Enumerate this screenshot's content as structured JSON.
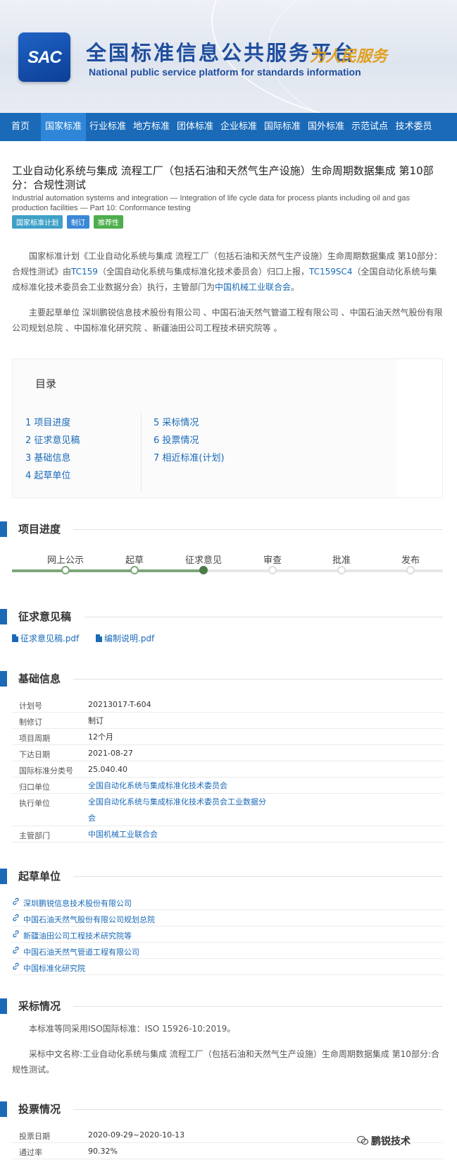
{
  "banner": {
    "logo_text": "SAC",
    "title_cn": "全国标准信息公共服务平台",
    "title_en": "National public service platform  for standards information",
    "slogan": "为人民服务"
  },
  "nav": {
    "items": [
      "首页",
      "国家标准",
      "行业标准",
      "地方标准",
      "团体标准",
      "企业标准",
      "国际标准",
      "国外标准",
      "示范试点",
      "技术委员"
    ],
    "active_index": 1
  },
  "standard": {
    "title_cn": "工业自动化系统与集成 流程工厂（包括石油和天然气生产设施）生命周期数据集成 第10部分：合规性测试",
    "title_en": "Industrial automation systems and integration — Integration of life cycle data for process plants including oil and gas production facilities — Part 10: Conformance testing",
    "tags": [
      {
        "label": "国家标准计划",
        "color": "#3fa0c8"
      },
      {
        "label": "制订",
        "color": "#3a88d8"
      },
      {
        "label": "推荐性",
        "color": "#4cae4c"
      }
    ]
  },
  "intro": {
    "p1_a": "国家标准计划《工业自动化系统与集成 流程工厂（包括石油和天然气生产设施）生命周期数据集成 第10部分：合规性测试》由",
    "p1_link1": "TC159",
    "p1_b": "（全国自动化系统与集成标准化技术委员会）归口上报，",
    "p1_link2": "TC159SC4",
    "p1_c": "（全国自动化系统与集成标准化技术委员会工业数据分会）执行，主管部门为",
    "p1_link3": "中国机械工业联合会",
    "p1_d": "。",
    "p2": "主要起草单位 深圳鹏锐信息技术股份有限公司 、中国石油天然气管道工程有限公司 、中国石油天然气股份有限公司规划总院 、中国标准化研究院 、新疆油田公司工程技术研究院等 。"
  },
  "toc": {
    "title": "目录",
    "left": [
      "1  项目进度",
      "2  征求意见稿",
      "3  基础信息",
      "4  起草单位"
    ],
    "right": [
      "5  采标情况",
      "6  投票情况",
      "7  相近标准(计划)"
    ]
  },
  "sections": {
    "progress": "项目进度",
    "drafts": "征求意见稿",
    "basic": "基础信息",
    "drafters": "起草单位",
    "adoption": "采标情况",
    "voting": "投票情况"
  },
  "progress": {
    "steps": [
      "网上公示",
      "起草",
      "征求意见",
      "审查",
      "批准",
      "发布"
    ],
    "current_index": 2
  },
  "files": [
    "征求意见稿.pdf",
    "编制说明.pdf"
  ],
  "basic_info": [
    {
      "key": "计划号",
      "value": "20213017-T-604",
      "link": false
    },
    {
      "key": "制修订",
      "value": "制订",
      "link": false
    },
    {
      "key": "项目周期",
      "value": "12个月",
      "link": false
    },
    {
      "key": "下达日期",
      "value": "2021-08-27",
      "link": false
    },
    {
      "key": "国际标准分类号",
      "value": "25.040.40",
      "link": false
    },
    {
      "key": "归口单位",
      "value": "全国自动化系统与集成标准化技术委员会",
      "link": true
    },
    {
      "key": "执行单位",
      "value": "全国自动化系统与集成标准化技术委员会工业数据分会",
      "link": true
    },
    {
      "key": "主管部门",
      "value": "中国机械工业联合会",
      "link": true
    }
  ],
  "drafter_units": [
    "深圳鹏锐信息技术股份有限公司",
    "中国石油天然气股份有限公司规划总院",
    "新疆油田公司工程技术研究院等",
    "中国石油天然气管道工程有限公司",
    "中国标准化研究院"
  ],
  "adoption": {
    "p1": "本标准等同采用ISO国际标准：ISO 15926-10:2019。",
    "p2": "采标中文名称:工业自动化系统与集成 流程工厂（包括石油和天然气生产设施）生命周期数据集成 第10部分:合规性测试。"
  },
  "voting": [
    {
      "key": "投票日期",
      "value": "2020-09-29~2020-10-13"
    },
    {
      "key": "通过率",
      "value": "90.32%"
    }
  ],
  "watermark": "鹏锐技术",
  "colors": {
    "accent": "#1a6ab8",
    "nav_bg": "#1a6ab8",
    "nav_active": "#2f86d8",
    "progress": "#7ea67a"
  }
}
